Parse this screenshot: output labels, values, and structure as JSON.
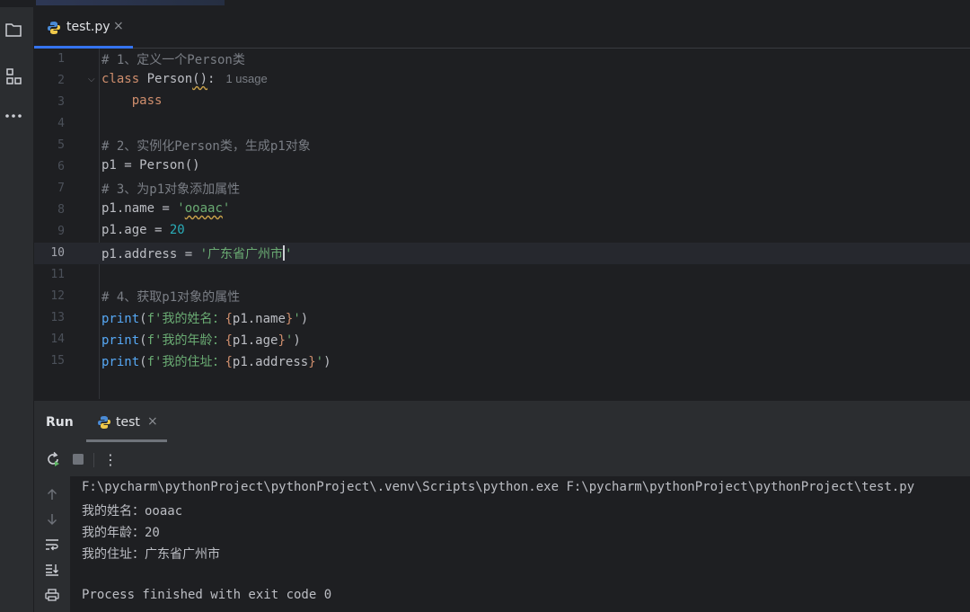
{
  "editor_tab": {
    "filename": "test.py",
    "close": "×"
  },
  "editor": {
    "usage_hint": "1 usage",
    "line_numbers": [
      "1",
      "2",
      "3",
      "4",
      "5",
      "6",
      "7",
      "8",
      "9",
      "10",
      "11",
      "12",
      "13",
      "14",
      "15"
    ],
    "current_line": "10"
  },
  "run_panel": {
    "title": "Run",
    "tab_label": "test",
    "tab_close": "×",
    "menu_glyph": "⋮"
  },
  "console": {
    "lines": [
      "F:\\pycharm\\pythonProject\\pythonProject\\.venv\\Scripts\\python.exe F:\\pycharm\\pythonProject\\pythonProject\\test.py",
      "我的姓名：ooaac",
      "我的年龄：20",
      "我的住址：广东省广州市",
      "",
      "Process finished with exit code 0"
    ]
  },
  "colors": {
    "background": "#1e1f22",
    "panel": "#2b2d30",
    "accent": "#3574f0",
    "keyword": "#cf8e6d",
    "string": "#6aab73",
    "number": "#2aacb8",
    "function": "#56a8f5",
    "comment": "#7a7e85"
  },
  "icons": {
    "toolstrip": [
      "folder-icon",
      "structure-icon",
      "more-icon"
    ],
    "run_toolbar": [
      "rerun-icon",
      "stop-icon",
      "options-icon"
    ],
    "console_side": [
      "scroll-up-icon",
      "scroll-down-icon",
      "soft-wrap-icon",
      "scroll-to-end-icon",
      "print-icon"
    ]
  }
}
